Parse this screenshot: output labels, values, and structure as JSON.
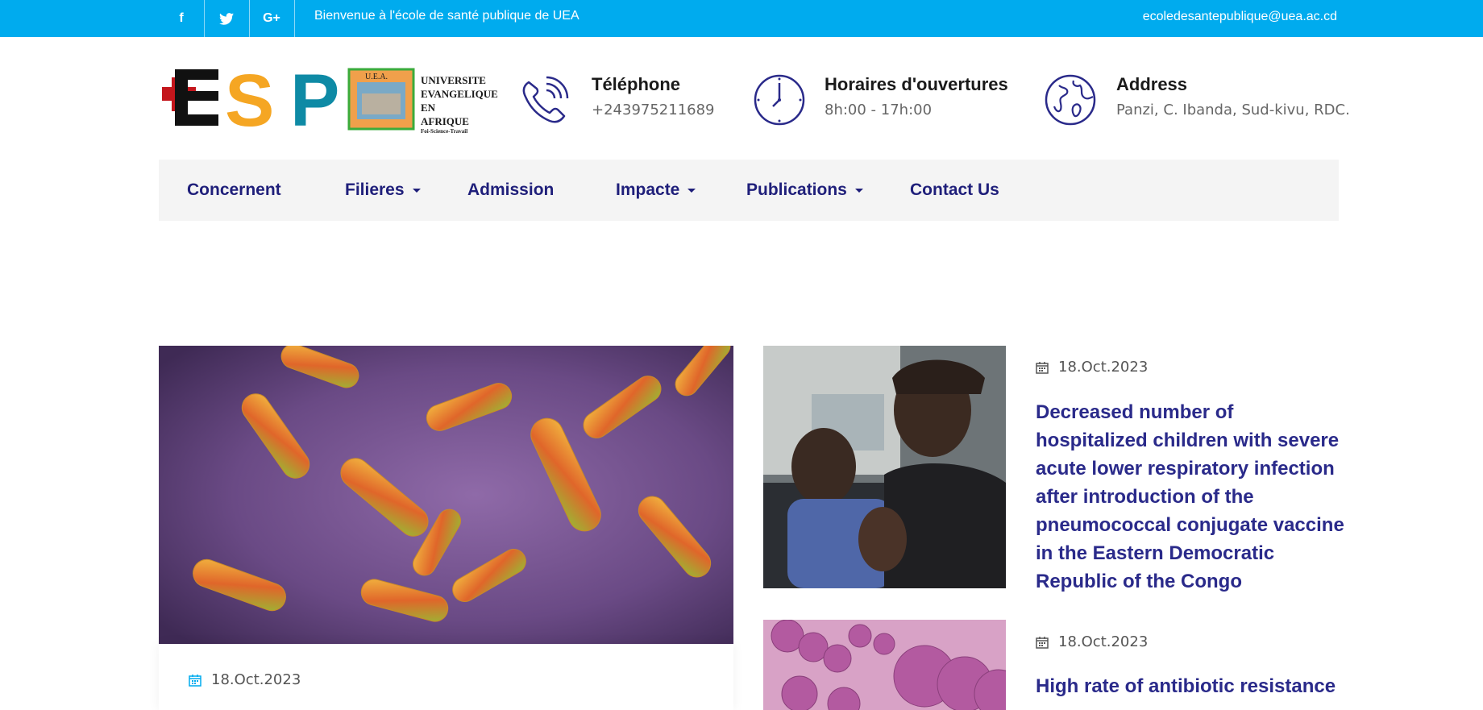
{
  "topbar": {
    "social": [
      {
        "name": "facebook",
        "glyph": "f"
      },
      {
        "name": "twitter",
        "glyph": "t"
      },
      {
        "name": "google-plus",
        "glyph": "G+"
      }
    ],
    "welcome": "Bienvenue à l'école de santé publique de UEA",
    "email": "ecoledesantepublique@uea.ac.cd"
  },
  "logo": {
    "esp": "ESP",
    "uea_badge": "U.E.A.",
    "uea_line1": "UNIVERSITE",
    "uea_line2": "EVANGELIQUE EN",
    "uea_line3": "AFRIQUE",
    "uea_motto": "Foi-Science-Travail"
  },
  "contacts": [
    {
      "title": "Téléphone",
      "value": "+243975211689",
      "icon": "phone-icon"
    },
    {
      "title": "Horaires d'ouvertures",
      "value": "8h:00 - 17h:00",
      "icon": "clock-icon"
    },
    {
      "title": "Address",
      "value": "Panzi, C. Ibanda, Sud-kivu, RDC.",
      "icon": "globe-icon"
    }
  ],
  "nav": [
    {
      "label": "Concernent",
      "dropdown": false
    },
    {
      "label": "Filieres",
      "dropdown": true
    },
    {
      "label": "Admission",
      "dropdown": false
    },
    {
      "label": "Impacte",
      "dropdown": true
    },
    {
      "label": "Publications",
      "dropdown": true
    },
    {
      "label": "Contact Us",
      "dropdown": false
    }
  ],
  "feature": {
    "date": "18.Oct.2023"
  },
  "posts": [
    {
      "date": "18.Oct.2023",
      "title": "Decreased number of hospitalized children with severe acute lower respiratory infection after introduction of the pneumococcal conjugate vaccine in the Eastern Democratic Republic of the Congo"
    },
    {
      "date": "18.Oct.2023",
      "title": "High rate of antibiotic resistance"
    }
  ],
  "colors": {
    "topbar": "#00abee",
    "nav_text": "#1f1f7a",
    "post_title": "#2a2a8a",
    "date_icon_accent": "#00abee"
  }
}
